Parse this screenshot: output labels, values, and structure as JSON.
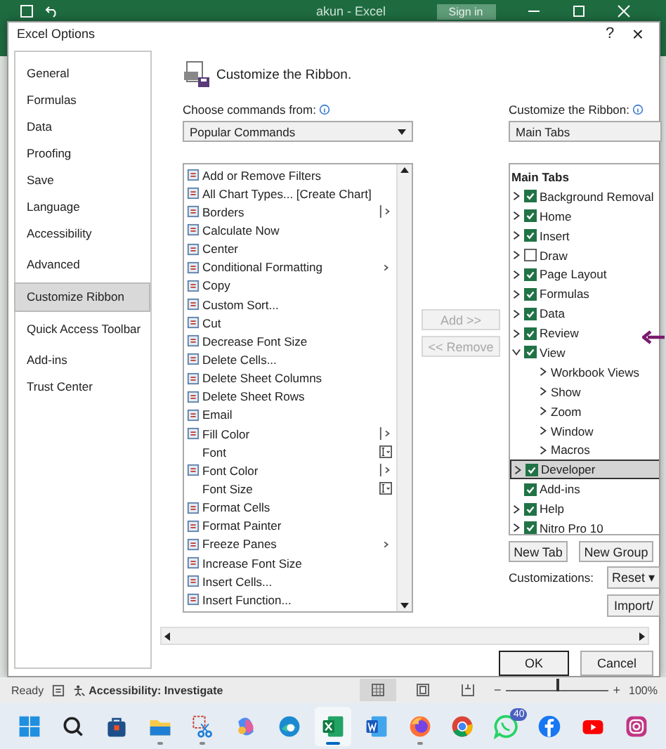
{
  "app_bar": {
    "title": "akun - Excel",
    "sign_in": "Sign in"
  },
  "dialog": {
    "title": "Excel Options",
    "help": "?",
    "close": "×"
  },
  "nav": [
    {
      "label": "General",
      "selected": false
    },
    {
      "label": "Formulas",
      "selected": false
    },
    {
      "label": "Data",
      "selected": false
    },
    {
      "label": "Proofing",
      "selected": false
    },
    {
      "label": "Save",
      "selected": false
    },
    {
      "label": "Language",
      "selected": false
    },
    {
      "label": "Accessibility",
      "selected": false
    },
    {
      "label": "Advanced",
      "selected": false
    },
    {
      "label": "Customize Ribbon",
      "selected": true
    },
    {
      "label": "Quick Access Toolbar",
      "selected": false
    },
    {
      "label": "Add-ins",
      "selected": false
    },
    {
      "label": "Trust Center",
      "selected": false
    }
  ],
  "heading": "Customize the Ribbon.",
  "commands_label": "Choose commands from:",
  "commands_source": "Popular Commands",
  "commands": [
    {
      "label": "Add or Remove Filters",
      "kind": "button"
    },
    {
      "label": "All Chart Types... [Create Chart]",
      "kind": "button"
    },
    {
      "label": "Borders",
      "kind": "split"
    },
    {
      "label": "Calculate Now",
      "kind": "button"
    },
    {
      "label": "Center",
      "kind": "button"
    },
    {
      "label": "Conditional Formatting",
      "kind": "menu"
    },
    {
      "label": "Copy",
      "kind": "button"
    },
    {
      "label": "Custom Sort...",
      "kind": "button"
    },
    {
      "label": "Cut",
      "kind": "button"
    },
    {
      "label": "Decrease Font Size",
      "kind": "button"
    },
    {
      "label": "Delete Cells...",
      "kind": "button"
    },
    {
      "label": "Delete Sheet Columns",
      "kind": "button"
    },
    {
      "label": "Delete Sheet Rows",
      "kind": "button"
    },
    {
      "label": "Email",
      "kind": "button"
    },
    {
      "label": "Fill Color",
      "kind": "split"
    },
    {
      "label": "Font",
      "kind": "combo"
    },
    {
      "label": "Font Color",
      "kind": "split"
    },
    {
      "label": "Font Size",
      "kind": "combo"
    },
    {
      "label": "Format Cells",
      "kind": "button"
    },
    {
      "label": "Format Painter",
      "kind": "button"
    },
    {
      "label": "Freeze Panes",
      "kind": "menu"
    },
    {
      "label": "Increase Font Size",
      "kind": "button"
    },
    {
      "label": "Insert Cells...",
      "kind": "button"
    },
    {
      "label": "Insert Function...",
      "kind": "button"
    }
  ],
  "add_button": {
    "label": "Add >>",
    "disabled": true
  },
  "remove_button": {
    "label": "<< Remove",
    "disabled": true
  },
  "ribbon_label": "Customize the Ribbon:",
  "ribbon_source": "Main Tabs",
  "tree": {
    "header": "Main Tabs",
    "items": [
      {
        "label": "Background Removal",
        "checked": true,
        "expandable": true,
        "selected": false
      },
      {
        "label": "Home",
        "checked": true,
        "expandable": true,
        "selected": false
      },
      {
        "label": "Insert",
        "checked": true,
        "expandable": true,
        "selected": false
      },
      {
        "label": "Draw",
        "checked": false,
        "expandable": true,
        "selected": false
      },
      {
        "label": "Page Layout",
        "checked": true,
        "expandable": true,
        "selected": false
      },
      {
        "label": "Formulas",
        "checked": true,
        "expandable": true,
        "selected": false
      },
      {
        "label": "Data",
        "checked": true,
        "expandable": true,
        "selected": false
      },
      {
        "label": "Review",
        "checked": true,
        "expandable": true,
        "selected": false
      },
      {
        "label": "View",
        "checked": true,
        "expandable": true,
        "selected": false,
        "children": [
          {
            "label": "Workbook Views"
          },
          {
            "label": "Show"
          },
          {
            "label": "Zoom"
          },
          {
            "label": "Window"
          },
          {
            "label": "Macros"
          }
        ]
      },
      {
        "label": "Developer",
        "checked": true,
        "expandable": true,
        "selected": true
      },
      {
        "label": "Add-ins",
        "checked": true,
        "expandable": false,
        "selected": false
      },
      {
        "label": "Help",
        "checked": true,
        "expandable": true,
        "selected": false
      },
      {
        "label": "Nitro Pro 10",
        "checked": true,
        "expandable": true,
        "selected": false
      }
    ]
  },
  "new_tab": "New Tab",
  "new_group": "New Group",
  "customizations_label": "Customizations:",
  "reset": "Reset ▾",
  "import": "Import/",
  "ok": "OK",
  "cancel": "Cancel",
  "status_bar": {
    "ready": "Ready",
    "accessibility": "Accessibility: Investigate",
    "zoom_out": "−",
    "zoom_in": "+",
    "zoom_slider": {
      "level": 0.5
    },
    "zoom": "100%"
  },
  "taskbar": [
    {
      "kind": "start",
      "selected": false,
      "running": false
    },
    {
      "kind": "search",
      "selected": false,
      "running": false
    },
    {
      "kind": "store",
      "selected": false,
      "running": false
    },
    {
      "kind": "folder",
      "selected": false,
      "running": true
    },
    {
      "kind": "snipping",
      "selected": false,
      "running": true
    },
    {
      "kind": "copilot",
      "selected": false,
      "running": false
    },
    {
      "kind": "edge",
      "selected": false,
      "running": false
    },
    {
      "kind": "excel",
      "selected": true,
      "running": true
    },
    {
      "kind": "word",
      "selected": false,
      "running": false
    },
    {
      "kind": "firefox",
      "selected": false,
      "running": true
    },
    {
      "kind": "chrome",
      "selected": false,
      "running": false
    },
    {
      "kind": "whatsapp",
      "selected": false,
      "running": false,
      "badge": "40"
    },
    {
      "kind": "facebook",
      "selected": false,
      "running": false
    },
    {
      "kind": "youtube",
      "selected": false,
      "running": false
    },
    {
      "kind": "instagram",
      "selected": false,
      "running": false
    }
  ]
}
